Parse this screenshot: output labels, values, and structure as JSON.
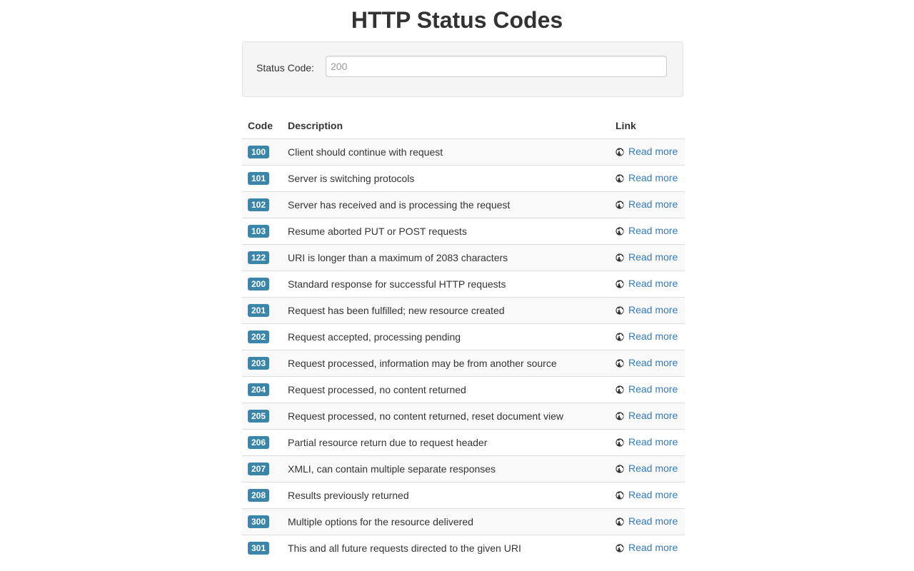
{
  "page": {
    "title": "HTTP Status Codes"
  },
  "filter": {
    "label": "Status Code:",
    "value": "",
    "placeholder": "200"
  },
  "table": {
    "headers": {
      "code": "Code",
      "description": "Description",
      "link": "Link"
    },
    "link_icon": "globe-icon",
    "rows": [
      {
        "code": "100",
        "description": "Client should continue with request",
        "link": "Read more"
      },
      {
        "code": "101",
        "description": "Server is switching protocols",
        "link": "Read more"
      },
      {
        "code": "102",
        "description": "Server has received and is processing the request",
        "link": "Read more"
      },
      {
        "code": "103",
        "description": "Resume aborted PUT or POST requests",
        "link": "Read more"
      },
      {
        "code": "122",
        "description": "URI is longer than a maximum of 2083 characters",
        "link": "Read more"
      },
      {
        "code": "200",
        "description": "Standard response for successful HTTP requests",
        "link": "Read more"
      },
      {
        "code": "201",
        "description": "Request has been fulfilled; new resource created",
        "link": "Read more"
      },
      {
        "code": "202",
        "description": "Request accepted, processing pending",
        "link": "Read more"
      },
      {
        "code": "203",
        "description": "Request processed, information may be from another source",
        "link": "Read more"
      },
      {
        "code": "204",
        "description": "Request processed, no content returned",
        "link": "Read more"
      },
      {
        "code": "205",
        "description": "Request processed, no content returned, reset document view",
        "link": "Read more"
      },
      {
        "code": "206",
        "description": "Partial resource return due to request header",
        "link": "Read more"
      },
      {
        "code": "207",
        "description": "XMLI, can contain multiple separate responses",
        "link": "Read more"
      },
      {
        "code": "208",
        "description": "Results previously returned",
        "link": "Read more"
      },
      {
        "code": "300",
        "description": "Multiple options for the resource delivered",
        "link": "Read more"
      },
      {
        "code": "301",
        "description": "This and all future requests directed to the given URI",
        "link": "Read more"
      }
    ]
  }
}
